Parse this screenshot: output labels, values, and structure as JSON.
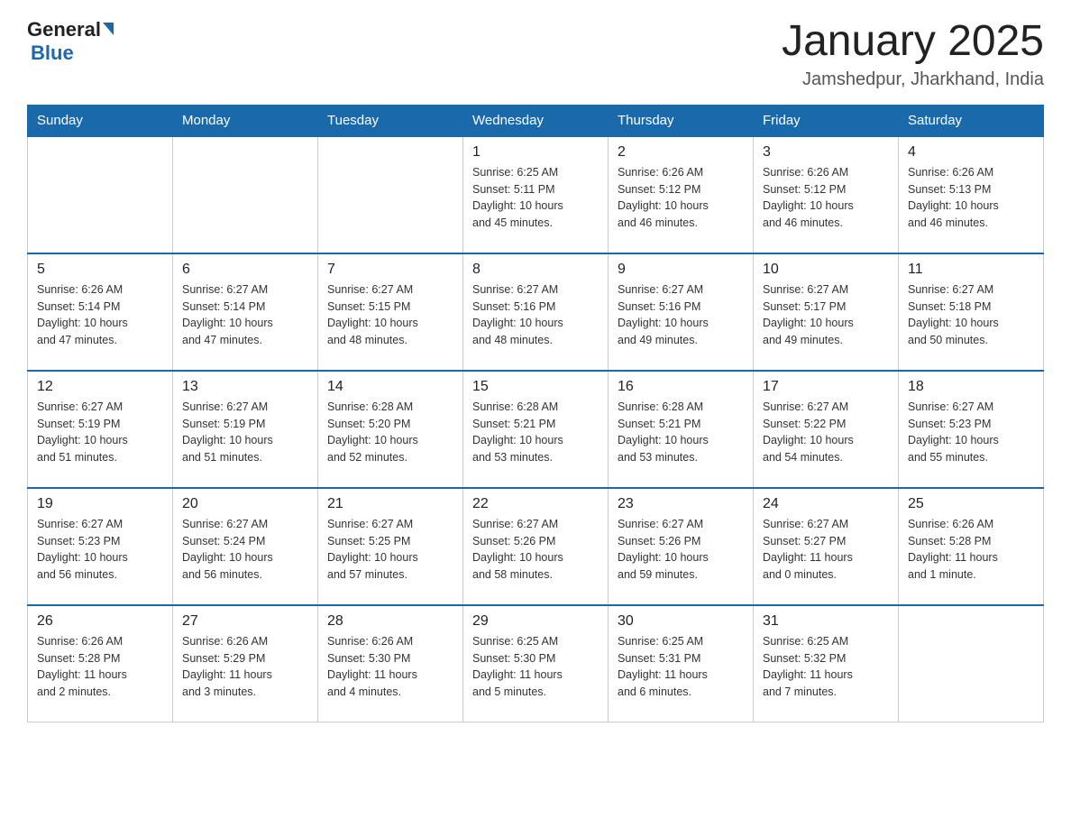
{
  "header": {
    "logo": {
      "general": "General",
      "blue": "Blue"
    },
    "title": "January 2025",
    "subtitle": "Jamshedpur, Jharkhand, India"
  },
  "weekdays": [
    "Sunday",
    "Monday",
    "Tuesday",
    "Wednesday",
    "Thursday",
    "Friday",
    "Saturday"
  ],
  "weeks": [
    [
      {
        "day": "",
        "info": ""
      },
      {
        "day": "",
        "info": ""
      },
      {
        "day": "",
        "info": ""
      },
      {
        "day": "1",
        "info": "Sunrise: 6:25 AM\nSunset: 5:11 PM\nDaylight: 10 hours\nand 45 minutes."
      },
      {
        "day": "2",
        "info": "Sunrise: 6:26 AM\nSunset: 5:12 PM\nDaylight: 10 hours\nand 46 minutes."
      },
      {
        "day": "3",
        "info": "Sunrise: 6:26 AM\nSunset: 5:12 PM\nDaylight: 10 hours\nand 46 minutes."
      },
      {
        "day": "4",
        "info": "Sunrise: 6:26 AM\nSunset: 5:13 PM\nDaylight: 10 hours\nand 46 minutes."
      }
    ],
    [
      {
        "day": "5",
        "info": "Sunrise: 6:26 AM\nSunset: 5:14 PM\nDaylight: 10 hours\nand 47 minutes."
      },
      {
        "day": "6",
        "info": "Sunrise: 6:27 AM\nSunset: 5:14 PM\nDaylight: 10 hours\nand 47 minutes."
      },
      {
        "day": "7",
        "info": "Sunrise: 6:27 AM\nSunset: 5:15 PM\nDaylight: 10 hours\nand 48 minutes."
      },
      {
        "day": "8",
        "info": "Sunrise: 6:27 AM\nSunset: 5:16 PM\nDaylight: 10 hours\nand 48 minutes."
      },
      {
        "day": "9",
        "info": "Sunrise: 6:27 AM\nSunset: 5:16 PM\nDaylight: 10 hours\nand 49 minutes."
      },
      {
        "day": "10",
        "info": "Sunrise: 6:27 AM\nSunset: 5:17 PM\nDaylight: 10 hours\nand 49 minutes."
      },
      {
        "day": "11",
        "info": "Sunrise: 6:27 AM\nSunset: 5:18 PM\nDaylight: 10 hours\nand 50 minutes."
      }
    ],
    [
      {
        "day": "12",
        "info": "Sunrise: 6:27 AM\nSunset: 5:19 PM\nDaylight: 10 hours\nand 51 minutes."
      },
      {
        "day": "13",
        "info": "Sunrise: 6:27 AM\nSunset: 5:19 PM\nDaylight: 10 hours\nand 51 minutes."
      },
      {
        "day": "14",
        "info": "Sunrise: 6:28 AM\nSunset: 5:20 PM\nDaylight: 10 hours\nand 52 minutes."
      },
      {
        "day": "15",
        "info": "Sunrise: 6:28 AM\nSunset: 5:21 PM\nDaylight: 10 hours\nand 53 minutes."
      },
      {
        "day": "16",
        "info": "Sunrise: 6:28 AM\nSunset: 5:21 PM\nDaylight: 10 hours\nand 53 minutes."
      },
      {
        "day": "17",
        "info": "Sunrise: 6:27 AM\nSunset: 5:22 PM\nDaylight: 10 hours\nand 54 minutes."
      },
      {
        "day": "18",
        "info": "Sunrise: 6:27 AM\nSunset: 5:23 PM\nDaylight: 10 hours\nand 55 minutes."
      }
    ],
    [
      {
        "day": "19",
        "info": "Sunrise: 6:27 AM\nSunset: 5:23 PM\nDaylight: 10 hours\nand 56 minutes."
      },
      {
        "day": "20",
        "info": "Sunrise: 6:27 AM\nSunset: 5:24 PM\nDaylight: 10 hours\nand 56 minutes."
      },
      {
        "day": "21",
        "info": "Sunrise: 6:27 AM\nSunset: 5:25 PM\nDaylight: 10 hours\nand 57 minutes."
      },
      {
        "day": "22",
        "info": "Sunrise: 6:27 AM\nSunset: 5:26 PM\nDaylight: 10 hours\nand 58 minutes."
      },
      {
        "day": "23",
        "info": "Sunrise: 6:27 AM\nSunset: 5:26 PM\nDaylight: 10 hours\nand 59 minutes."
      },
      {
        "day": "24",
        "info": "Sunrise: 6:27 AM\nSunset: 5:27 PM\nDaylight: 11 hours\nand 0 minutes."
      },
      {
        "day": "25",
        "info": "Sunrise: 6:26 AM\nSunset: 5:28 PM\nDaylight: 11 hours\nand 1 minute."
      }
    ],
    [
      {
        "day": "26",
        "info": "Sunrise: 6:26 AM\nSunset: 5:28 PM\nDaylight: 11 hours\nand 2 minutes."
      },
      {
        "day": "27",
        "info": "Sunrise: 6:26 AM\nSunset: 5:29 PM\nDaylight: 11 hours\nand 3 minutes."
      },
      {
        "day": "28",
        "info": "Sunrise: 6:26 AM\nSunset: 5:30 PM\nDaylight: 11 hours\nand 4 minutes."
      },
      {
        "day": "29",
        "info": "Sunrise: 6:25 AM\nSunset: 5:30 PM\nDaylight: 11 hours\nand 5 minutes."
      },
      {
        "day": "30",
        "info": "Sunrise: 6:25 AM\nSunset: 5:31 PM\nDaylight: 11 hours\nand 6 minutes."
      },
      {
        "day": "31",
        "info": "Sunrise: 6:25 AM\nSunset: 5:32 PM\nDaylight: 11 hours\nand 7 minutes."
      },
      {
        "day": "",
        "info": ""
      }
    ]
  ]
}
